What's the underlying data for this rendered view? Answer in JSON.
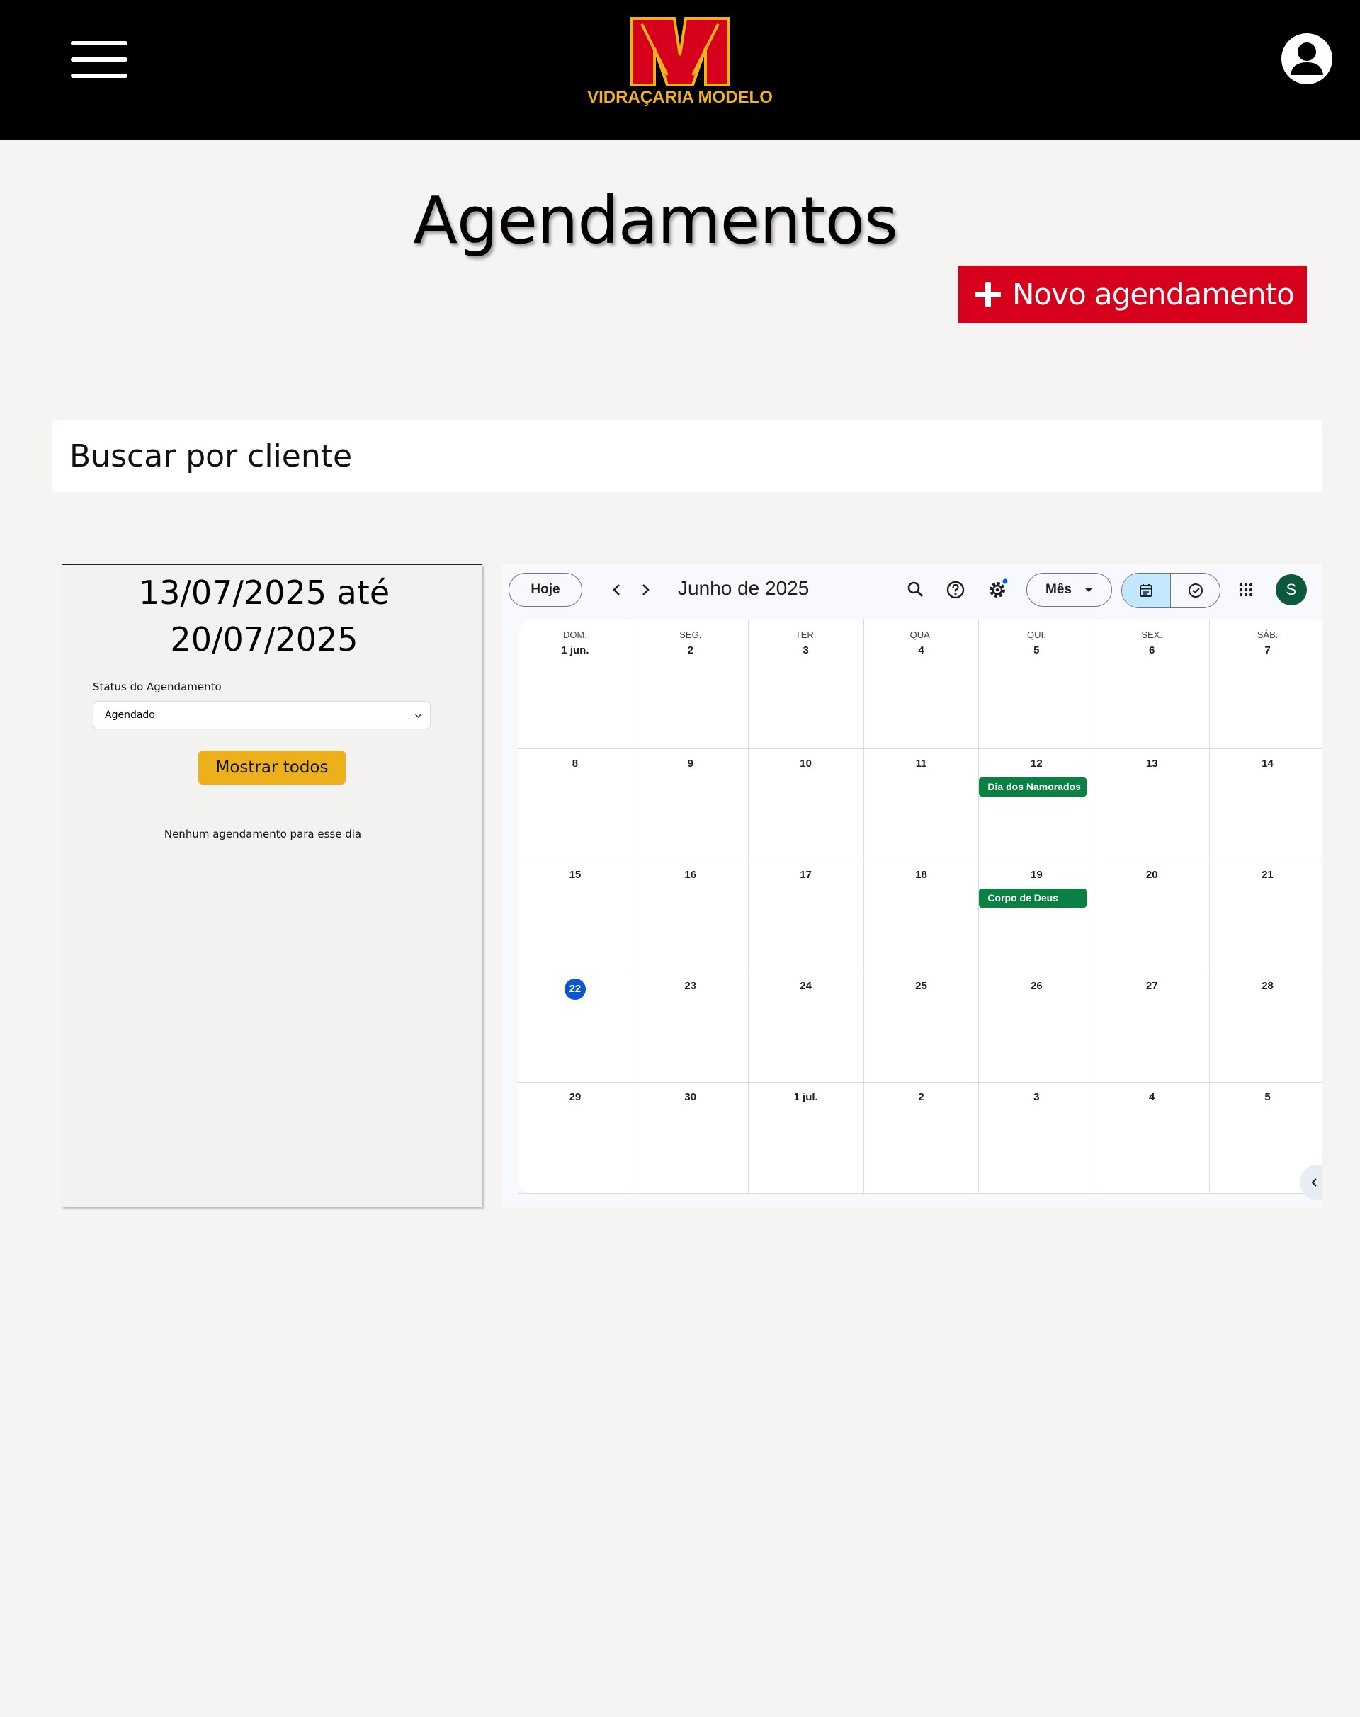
{
  "header": {
    "brand": "VIDRAÇARIA MODELO",
    "logo_letter": "M",
    "colors": {
      "bar": "#000000",
      "logo_red": "#d6001c",
      "logo_gold": "#f2b21a"
    }
  },
  "page": {
    "title": "Agendamentos",
    "new_button_label": "Novo agendamento",
    "search_placeholder": "Buscar por cliente"
  },
  "panel": {
    "range_line1": "13/07/2025 até",
    "range_line2": "20/07/2025",
    "status_label": "Status do Agendamento",
    "status_value": "Agendado",
    "show_all_label": "Mostrar todos",
    "empty_message": "Nenhum agendamento para esse dia"
  },
  "calendar": {
    "today_label": "Hoje",
    "month_label": "Junho de 2025",
    "view_label": "Mês",
    "avatar_letter": "S",
    "weekdays": [
      "DOM.",
      "SEG.",
      "TER.",
      "QUA.",
      "QUI.",
      "SEX.",
      "SÁB."
    ],
    "weeks": [
      [
        "1 jun.",
        "2",
        "3",
        "4",
        "5",
        "6",
        "7"
      ],
      [
        "8",
        "9",
        "10",
        "11",
        "12",
        "13",
        "14"
      ],
      [
        "15",
        "16",
        "17",
        "18",
        "19",
        "20",
        "21"
      ],
      [
        "22",
        "23",
        "24",
        "25",
        "26",
        "27",
        "28"
      ],
      [
        "29",
        "30",
        "1 jul.",
        "2",
        "3",
        "4",
        "5"
      ]
    ],
    "today_date": "22",
    "events": [
      {
        "week": 1,
        "day": 4,
        "label": "Dia dos Namorados"
      },
      {
        "week": 2,
        "day": 4,
        "label": "Corpo de Deus"
      }
    ],
    "colors": {
      "event": "#0b8043",
      "today": "#0b57d0",
      "view_active": "#c2e7ff"
    }
  }
}
